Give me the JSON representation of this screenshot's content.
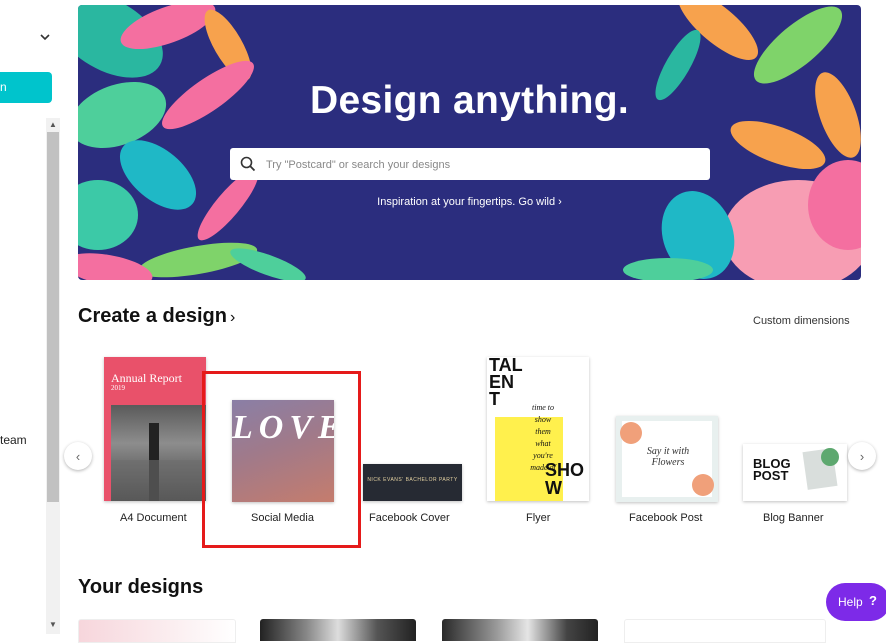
{
  "sidebar": {
    "button_label": "n",
    "team_label": "team"
  },
  "hero": {
    "title": "Design anything.",
    "search_placeholder": "Try \"Postcard\" or search your designs",
    "inspiration": "Inspiration at your fingertips. Go wild ›"
  },
  "create": {
    "title": "Create a design",
    "title_chevron": "›",
    "custom_dimensions": "Custom dimensions",
    "prev_icon": "‹",
    "next_icon": "›",
    "items": [
      {
        "label": "A4 Document"
      },
      {
        "label": "Social Media"
      },
      {
        "label": "Facebook Cover"
      },
      {
        "label": "Flyer"
      },
      {
        "label": "Facebook Post"
      },
      {
        "label": "Blog Banner"
      }
    ]
  },
  "thumbs": {
    "annual_report_title": "Annual Report",
    "annual_report_year": "2019",
    "love_text": "LOVE",
    "fb_cover_text": "NICK EVANS' BACHELOR PARTY",
    "flyer_talent": "TALENT",
    "flyer_show": "SHOW",
    "flyer_body": "time to show them what you're made of",
    "fb_post_text": "Say it with Flowers",
    "blog_text": "BLOG POST"
  },
  "your_designs": {
    "title": "Your designs"
  },
  "help": {
    "label": "Help",
    "icon": "?"
  },
  "colors": {
    "accent_teal": "#00c4cc",
    "hero_bg": "#2b2d7e",
    "highlight_red": "#e51a1a",
    "help_purple": "#7d2ae8"
  }
}
